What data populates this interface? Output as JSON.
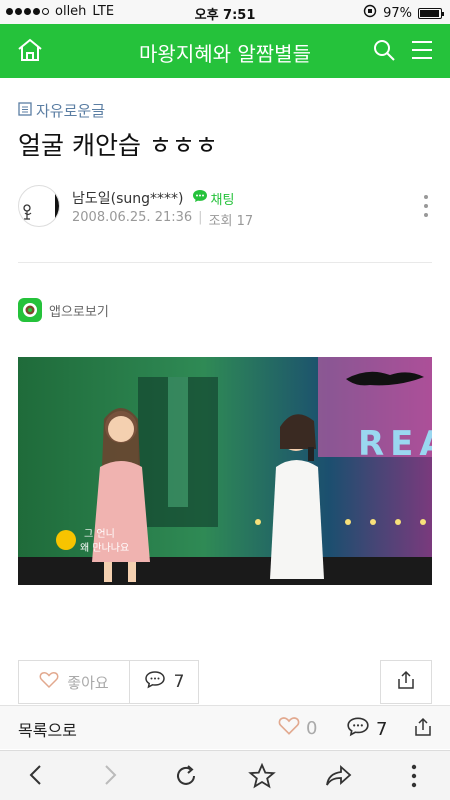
{
  "status_bar": {
    "carrier": "olleh",
    "network": "LTE",
    "time": "오후 7:51",
    "battery": "97%",
    "battery_level": 0.97
  },
  "header": {
    "title": "마왕지혜와 알짬별들",
    "icons": [
      "home-icon",
      "search-icon",
      "menu-icon"
    ]
  },
  "post": {
    "category": "자유로운글",
    "title": "얼굴 캐안습 ㅎㅎㅎ",
    "author": "남도일(sung****)",
    "chat_label": "채팅",
    "date": "2008.06.25. 21:36",
    "views": "조회 17"
  },
  "app_view": {
    "label": "앱으로보기"
  },
  "photo": {
    "caption_line1": "그 언니",
    "caption_line2": "왜 만나나요",
    "sign_text": "REA"
  },
  "actions": {
    "like_label": "좋아요",
    "comment_count": "7"
  },
  "bottom_bar": {
    "list_label": "목록으로",
    "like_count": "0",
    "comment_count": "7"
  },
  "colors": {
    "brand_green": "#25c23b",
    "category_blue": "#5b7ea3"
  }
}
